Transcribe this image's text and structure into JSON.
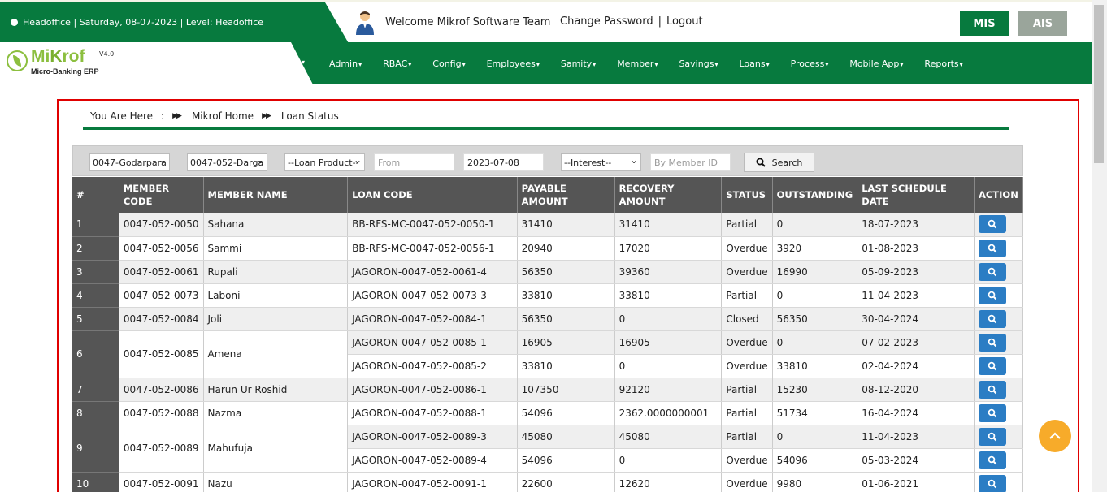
{
  "topbar": {
    "info": "Headoffice | Saturday, 08-07-2023 | Level: Headoffice",
    "welcome": "Welcome Mikrof Software Team",
    "change_password": "Change Password",
    "separator": "|",
    "logout": "Logout",
    "mis_label": "MIS",
    "ais_label": "AIS"
  },
  "logo": {
    "brand_mi": "Mi",
    "brand_k": "K",
    "brand_rof": "rof",
    "version": "V4.0",
    "subtitle": "Micro-Banking ERP"
  },
  "nav": {
    "items": [
      "Admin",
      "RBAC",
      "Config",
      "Employees",
      "Samity",
      "Member",
      "Savings",
      "Loans",
      "Process",
      "Mobile App",
      "Reports"
    ]
  },
  "breadcrumb": {
    "you_are_here": "You Are Here",
    "colon": ":",
    "home": "Mikrof Home",
    "current": "Loan Status"
  },
  "filters": {
    "branch": "0047-Godarpara",
    "samity": "0047-052-Darga",
    "loan_product": "--Loan Product--",
    "from_placeholder": "From",
    "to_value": "2023-07-08",
    "interest": "--Interest--",
    "member_placeholder": "By Member ID",
    "search_label": "Search"
  },
  "table": {
    "headers": [
      "#",
      "MEMBER CODE",
      "MEMBER NAME",
      "LOAN CODE",
      "PAYABLE AMOUNT",
      "RECOVERY AMOUNT",
      "STATUS",
      "OUTSTANDING",
      "LAST SCHEDULE DATE",
      "ACTION"
    ],
    "groups": [
      {
        "num": "1",
        "code": "0047-052-0050",
        "name": "Sahana",
        "loans": [
          {
            "loan_code": "BB-RFS-MC-0047-052-0050-1",
            "payable": "31410",
            "recovery": "31410",
            "status": "Partial",
            "outstanding": "0",
            "date": "18-07-2023"
          }
        ]
      },
      {
        "num": "2",
        "code": "0047-052-0056",
        "name": "Sammi",
        "loans": [
          {
            "loan_code": "BB-RFS-MC-0047-052-0056-1",
            "payable": "20940",
            "recovery": "17020",
            "status": "Overdue",
            "outstanding": "3920",
            "date": "01-08-2023"
          }
        ]
      },
      {
        "num": "3",
        "code": "0047-052-0061",
        "name": "Rupali",
        "loans": [
          {
            "loan_code": "JAGORON-0047-052-0061-4",
            "payable": "56350",
            "recovery": "39360",
            "status": "Overdue",
            "outstanding": "16990",
            "date": "05-09-2023"
          }
        ]
      },
      {
        "num": "4",
        "code": "0047-052-0073",
        "name": "Laboni",
        "loans": [
          {
            "loan_code": "JAGORON-0047-052-0073-3",
            "payable": "33810",
            "recovery": "33810",
            "status": "Partial",
            "outstanding": "0",
            "date": "11-04-2023"
          }
        ]
      },
      {
        "num": "5",
        "code": "0047-052-0084",
        "name": "Joli",
        "loans": [
          {
            "loan_code": "JAGORON-0047-052-0084-1",
            "payable": "56350",
            "recovery": "0",
            "status": "Closed",
            "outstanding": "56350",
            "date": "30-04-2024"
          }
        ]
      },
      {
        "num": "6",
        "code": "0047-052-0085",
        "name": "Amena",
        "loans": [
          {
            "loan_code": "JAGORON-0047-052-0085-1",
            "payable": "16905",
            "recovery": "16905",
            "status": "Overdue",
            "outstanding": "0",
            "date": "07-02-2023"
          },
          {
            "loan_code": "JAGORON-0047-052-0085-2",
            "payable": "33810",
            "recovery": "0",
            "status": "Overdue",
            "outstanding": "33810",
            "date": "02-04-2024"
          }
        ]
      },
      {
        "num": "7",
        "code": "0047-052-0086",
        "name": "Harun Ur Roshid",
        "loans": [
          {
            "loan_code": "JAGORON-0047-052-0086-1",
            "payable": "107350",
            "recovery": "92120",
            "status": "Partial",
            "outstanding": "15230",
            "date": "08-12-2020"
          }
        ]
      },
      {
        "num": "8",
        "code": "0047-052-0088",
        "name": "Nazma",
        "loans": [
          {
            "loan_code": "JAGORON-0047-052-0088-1",
            "payable": "54096",
            "recovery": "2362.0000000001",
            "status": "Partial",
            "outstanding": "51734",
            "date": "16-04-2024"
          }
        ]
      },
      {
        "num": "9",
        "code": "0047-052-0089",
        "name": "Mahufuja",
        "loans": [
          {
            "loan_code": "JAGORON-0047-052-0089-3",
            "payable": "45080",
            "recovery": "45080",
            "status": "Partial",
            "outstanding": "0",
            "date": "11-04-2023"
          },
          {
            "loan_code": "JAGORON-0047-052-0089-4",
            "payable": "54096",
            "recovery": "0",
            "status": "Overdue",
            "outstanding": "54096",
            "date": "05-03-2024"
          }
        ]
      },
      {
        "num": "10",
        "code": "0047-052-0091",
        "name": "Nazu",
        "loans": [
          {
            "loan_code": "JAGORON-0047-052-0091-1",
            "payable": "22600",
            "recovery": "12620",
            "status": "Overdue",
            "outstanding": "9980",
            "date": "01-06-2021"
          }
        ]
      }
    ]
  },
  "colors": {
    "brand_green": "#077a3e",
    "header_gray": "#555555",
    "action_blue": "#2b7dc4",
    "scroll_top_orange": "#f7ab2a",
    "border_red": "#e00000"
  },
  "icons": {
    "info": "globe-icon",
    "user": "user-avatar-icon",
    "breadcrumb_sep": "double-chevron-right-icon",
    "search": "magnifier-icon",
    "action": "magnifier-icon",
    "to_top": "chevron-up-icon"
  }
}
